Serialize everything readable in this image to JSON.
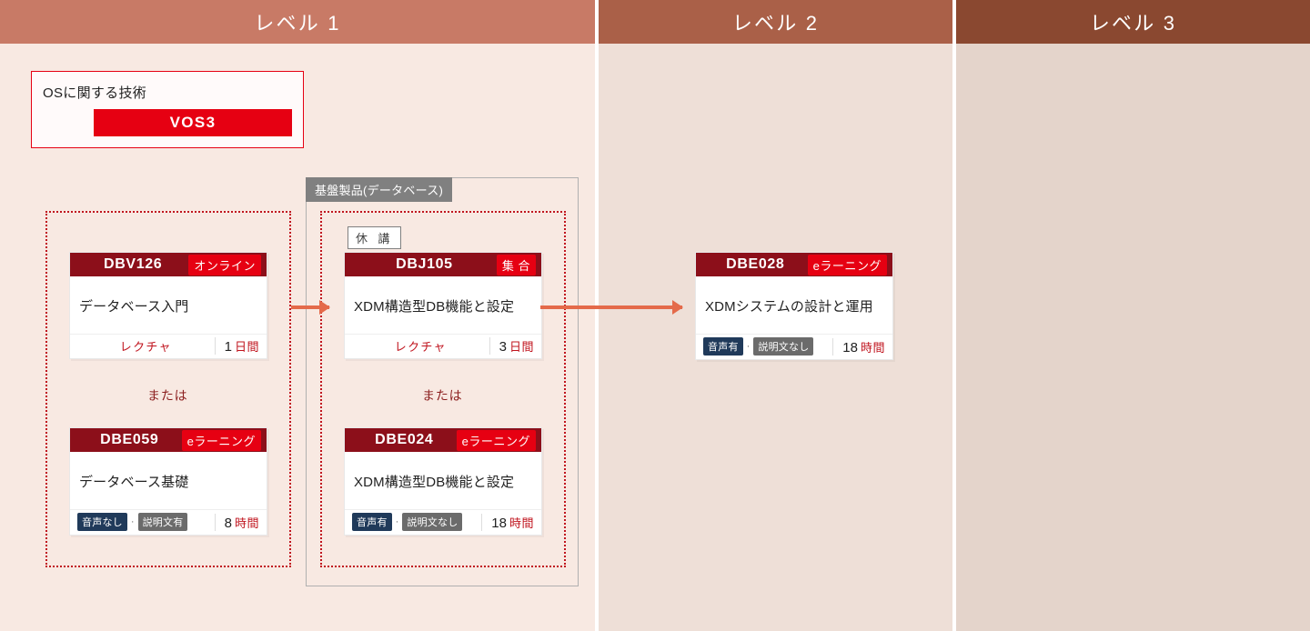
{
  "levels": {
    "l1": "レベル 1",
    "l2": "レベル 2",
    "l3": "レベル 3"
  },
  "legend": {
    "title": "OSに関する技術",
    "badge": "VOS3"
  },
  "db_tag": "基盤製品(データベース)",
  "suspended_label": "休 講",
  "or_label": "または",
  "cards": {
    "dbv126": {
      "code": "DBV126",
      "mode": "オンライン",
      "title": "データベース入門",
      "footer_kind": "lecture",
      "lecture_label": "レクチャ",
      "value": "1",
      "unit": "日間"
    },
    "dbe059": {
      "code": "DBE059",
      "mode": "eラーニング",
      "title": "データベース基礎",
      "footer_kind": "chips",
      "chip_audio": "音声なし",
      "chip_explain": "説明文有",
      "value": "8",
      "unit": "時間"
    },
    "dbj105": {
      "code": "DBJ105",
      "mode": "集 合",
      "title": "XDM構造型DB機能と設定",
      "footer_kind": "lecture",
      "lecture_label": "レクチャ",
      "value": "3",
      "unit": "日間"
    },
    "dbe024": {
      "code": "DBE024",
      "mode": "eラーニング",
      "title": "XDM構造型DB機能と設定",
      "footer_kind": "chips",
      "chip_audio": "音声有",
      "chip_explain": "説明文なし",
      "value": "18",
      "unit": "時間"
    },
    "dbe028": {
      "code": "DBE028",
      "mode": "eラーニング",
      "title": "XDMシステムの設計と運用",
      "footer_kind": "chips",
      "chip_audio": "音声有",
      "chip_explain": "説明文なし",
      "value": "18",
      "unit": "時間"
    }
  }
}
